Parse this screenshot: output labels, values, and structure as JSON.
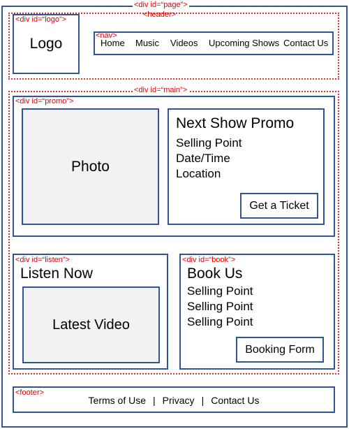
{
  "labels": {
    "page": "<div id=“page”>",
    "header": "<header>",
    "logo_div": "<div id=“logo”>",
    "nav": "<nav>",
    "main": "<div id=“main”>",
    "promo": "<div id=“promo”>",
    "listen": "<div id=“listen”>",
    "book": "<div id=“book”>",
    "footer": "<footer>"
  },
  "header": {
    "logo": "Logo",
    "nav_items": [
      "Home",
      "Music",
      "Videos",
      "Upcoming Shows",
      "Contact Us"
    ]
  },
  "promo": {
    "photo": "Photo",
    "title": "Next Show Promo",
    "lines": [
      "Selling Point",
      "Date/Time",
      "Location"
    ],
    "button": "Get a Ticket"
  },
  "listen": {
    "title": "Listen Now",
    "video": "Latest Video"
  },
  "book": {
    "title": "Book Us",
    "lines": [
      "Selling Point",
      "Selling Point",
      "Selling Point"
    ],
    "button": "Booking Form"
  },
  "footer": {
    "links": [
      "Terms of Use",
      "Privacy",
      "Contact Us"
    ],
    "separator": "|"
  },
  "colors": {
    "box_border": "#2f5597",
    "container_border": "#e03030",
    "label_text": "#e00000",
    "placeholder_fill": "#f2f2f2"
  }
}
